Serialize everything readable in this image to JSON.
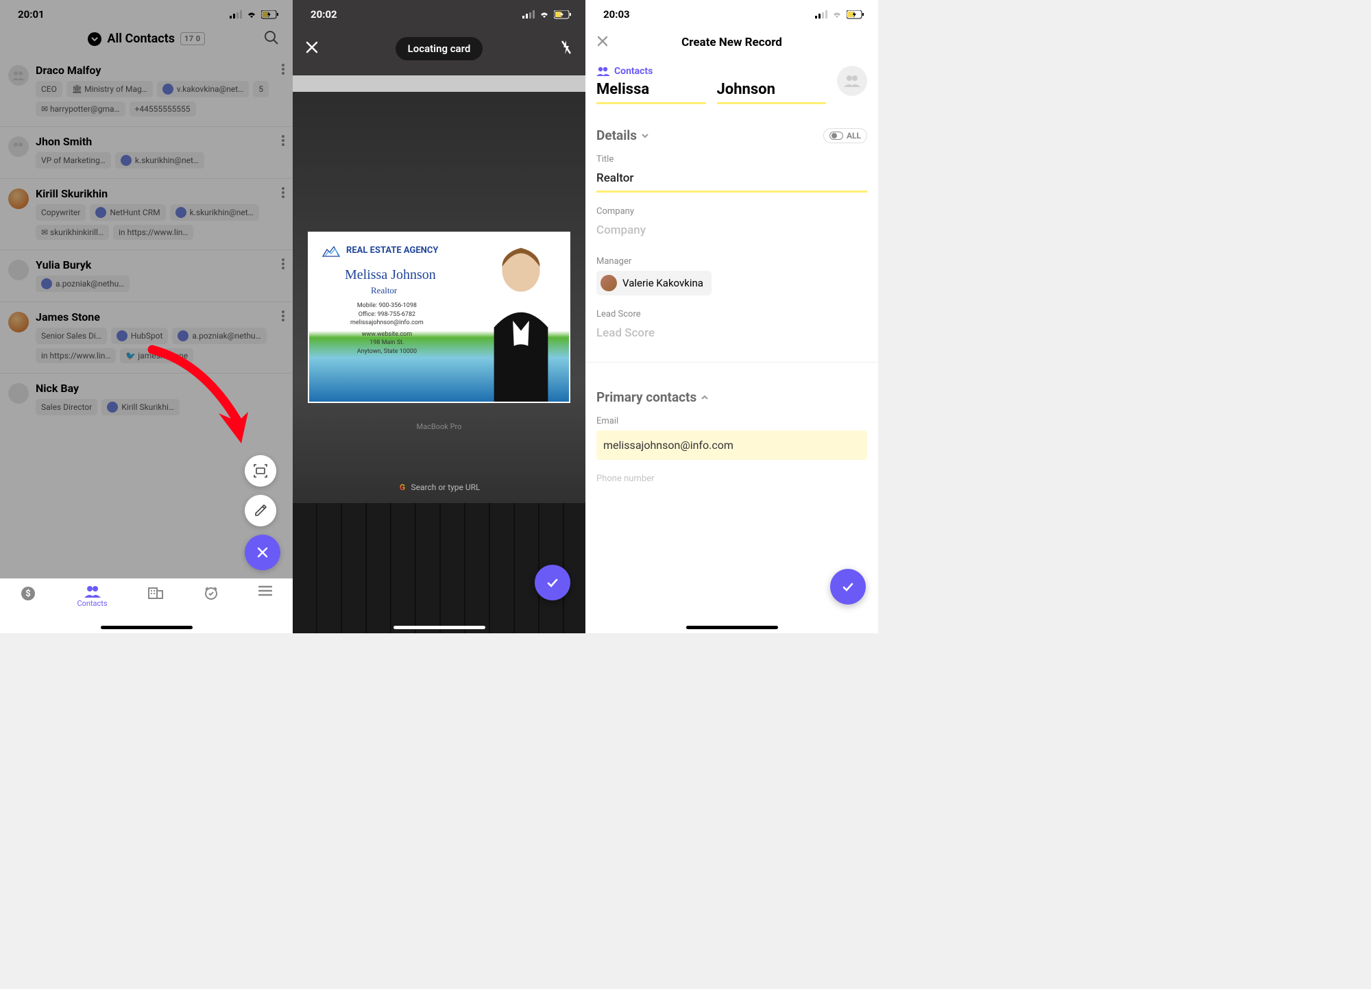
{
  "status": {
    "s1_time": "20:01",
    "s2_time": "20:02",
    "s3_time": "20:03"
  },
  "screen1": {
    "header_title": "All Contacts",
    "header_count": "17 0",
    "nav_contacts": "Contacts",
    "contacts": [
      {
        "name": "Draco Malfoy",
        "chips": [
          "CEO",
          "🏛 Ministry of Mag…",
          "v.kakovkina@net…",
          "5",
          "✉ harrypotter@gma…",
          "+44555555555"
        ]
      },
      {
        "name": "Jhon Smith",
        "chips": [
          "VP of Marketing…",
          "k.skurikhin@net…"
        ]
      },
      {
        "name": "Kirill Skurikhin",
        "chips": [
          "Copywriter",
          "NetHunt CRM",
          "k.skurikhin@net…",
          "✉ skurikhinkirill…",
          "in https://www.lin…"
        ]
      },
      {
        "name": "Yulia Buryk",
        "chips": [
          "a.pozniak@nethu…"
        ]
      },
      {
        "name": "James Stone",
        "chips": [
          "Senior Sales Di…",
          "HubSpot",
          "a.pozniak@nethu…",
          "in https://www.lin…",
          "🐦 jamesmstone"
        ]
      },
      {
        "name": "Nick Bay",
        "chips": [
          "Sales Director",
          "Kirill Skurikhi…"
        ]
      }
    ]
  },
  "screen2": {
    "pill": "Locating card",
    "biz_agency": "REAL ESTATE AGENCY",
    "biz_name": "Melissa Johnson",
    "biz_role": "Realtor",
    "biz_l1": "Mobile: 900-356-1098",
    "biz_l2": "Office: 998-755-6782",
    "biz_l3": "melissajohnson@info.com",
    "biz_l4": "www.website.com",
    "biz_l5": "198 Main St.",
    "biz_l6": "Anytown, State 10000",
    "macbook": "MacBook Pro",
    "search_hint": "Search or type URL"
  },
  "screen3": {
    "title": "Create New Record",
    "folder": "Contacts",
    "first_name": "Melissa",
    "last_name": "Johnson",
    "details": "Details",
    "all": "ALL",
    "f_title_lbl": "Title",
    "f_title_val": "Realtor",
    "f_company_lbl": "Company",
    "f_company_ph": "Company",
    "f_manager_lbl": "Manager",
    "f_manager_val": "Valerie Kakovkina",
    "f_leadscore_lbl": "Lead Score",
    "f_leadscore_ph": "Lead Score",
    "primary_contacts": "Primary contacts",
    "f_email_lbl": "Email",
    "f_email_val": "melissajohnson@info.com",
    "f_phone_lbl": "Phone number"
  }
}
